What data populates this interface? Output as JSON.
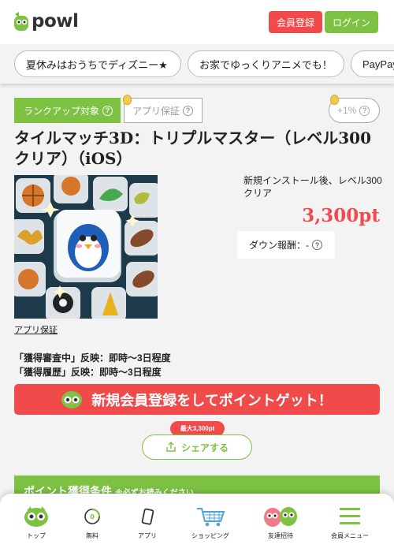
{
  "header": {
    "logo_text": "powl",
    "register_label": "会員登録",
    "login_label": "ログイン"
  },
  "pills": [
    {
      "label": "夏休みはおうちでディズニー★"
    },
    {
      "label": "お家でゆっくりアニメでも！"
    },
    {
      "label": "PayPay"
    }
  ],
  "offer": {
    "rankup_label": "ランクアップ対象",
    "guarantee_label": "アプリ保証",
    "bonus_label": "+1%",
    "title": "タイルマッチ3D：トリプルマスター（レベル300クリア）（iOS）",
    "condition": "新規インストール後、レベル300クリア",
    "points": "3,300pt",
    "down_reward_label": "ダウン報酬：-",
    "guarantee_link": "アプリ保証",
    "reflect_pending": "「獲得審査中」反映：即時～3日程度",
    "reflect_history": "「獲得履歴」反映：即時～3日程度"
  },
  "cta": {
    "register_label": "新規会員登録をしてポイントゲット！",
    "share_badge": "最大3,300pt",
    "share_label": "シェアする"
  },
  "conditions": {
    "title": "ポイント獲得条件",
    "note": "※必ずお読みください"
  },
  "bottom_nav": [
    {
      "label": "トップ",
      "icon": "owl-icon"
    },
    {
      "label": "無料",
      "icon": "free-coin-icon"
    },
    {
      "label": "アプリ",
      "icon": "smartphone-icon"
    },
    {
      "label": "ショッピング",
      "icon": "cart-icon"
    },
    {
      "label": "友達招待",
      "icon": "friends-icon"
    },
    {
      "label": "会員メニュー",
      "icon": "menu-icon"
    }
  ],
  "colors": {
    "brand_green": "#7dc242",
    "accent_red": "#f04a4a"
  }
}
